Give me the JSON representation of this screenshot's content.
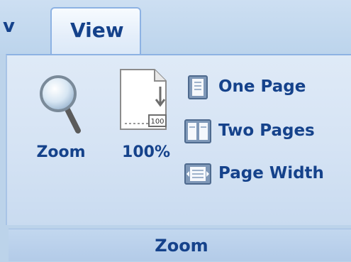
{
  "tabs": {
    "prev_tab_fragment": "v",
    "active_tab": "View"
  },
  "group": {
    "name": "Zoom",
    "buttons": {
      "zoom": {
        "label": "Zoom",
        "icon": "magnifier-icon"
      },
      "hundred": {
        "label": "100%",
        "icon_badge": "100",
        "icon": "page-100-icon"
      },
      "one_page": {
        "label": "One Page",
        "icon": "one-page-icon"
      },
      "two_pages": {
        "label": "Two Pages",
        "icon": "two-pages-icon"
      },
      "page_width": {
        "label": "Page Width",
        "icon": "page-width-icon"
      }
    }
  },
  "colors": {
    "text": "#15428b",
    "ribbon_bg": "#d5e3f4",
    "border": "#8db2e3"
  }
}
